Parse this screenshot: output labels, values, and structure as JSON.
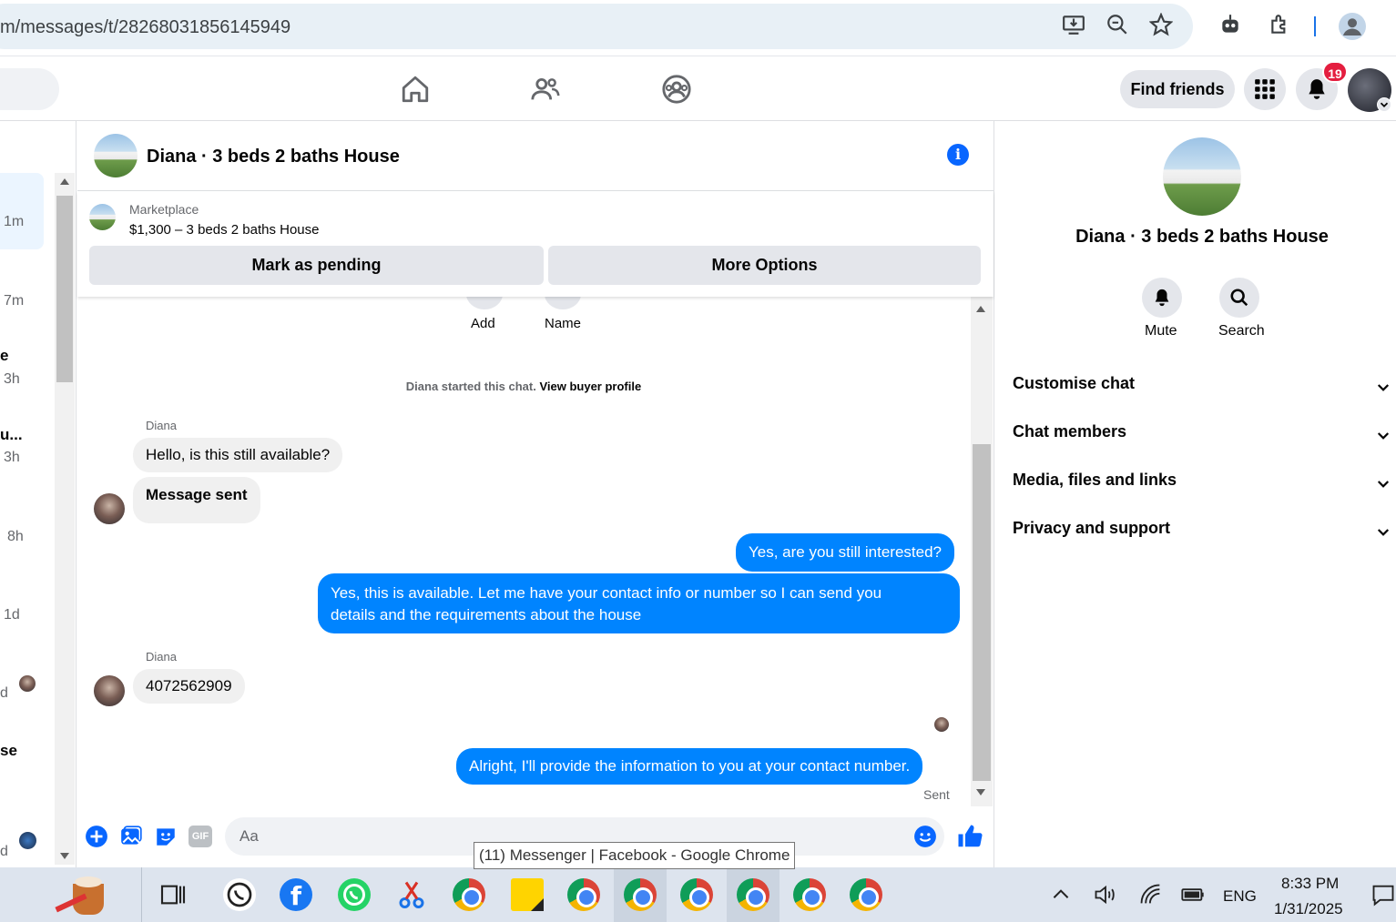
{
  "browser": {
    "url": "m/messages/t/28268031856145949",
    "tooltip": "(11) Messenger | Facebook - Google Chrome"
  },
  "nav": {
    "find_friends": "Find friends",
    "notif_count": "19"
  },
  "left_list": {
    "times": [
      "1m",
      "7m",
      "3h",
      "3h",
      "8h",
      "1d"
    ],
    "fragments": [
      "e",
      "u...",
      "d",
      "se",
      "d"
    ]
  },
  "chat": {
    "title": "Diana · 3 beds 2 baths House",
    "marketplace_label": "Marketplace",
    "marketplace_item": "$1,300 – 3 beds 2 baths House",
    "mark_pending": "Mark as pending",
    "more_options": "More Options",
    "quick_add": "Add",
    "quick_name": "Name",
    "started_text": "Diana started this chat.",
    "view_profile": "View buyer profile",
    "sender_name": "Diana",
    "msg1": "Hello, is this still available?",
    "msg2": "Message sent",
    "msg3": "Yes, are you still interested?",
    "msg4_line1": "Yes, this is available. Let me have your contact info or number so I can send you",
    "msg4_line2": "details and the requirements about the house",
    "sender_name2": "Diana",
    "msg5": "4072562909",
    "msg6": "Alright, I'll provide the information to you at your contact number.",
    "sent_status": "Sent",
    "input_placeholder": "Aa"
  },
  "right_panel": {
    "name": "Diana · 3 beds 2 baths House",
    "mute": "Mute",
    "search": "Search",
    "sections": [
      "Customise chat",
      "Chat members",
      "Media, files and links",
      "Privacy and support"
    ]
  },
  "taskbar": {
    "lang": "ENG",
    "time": "8:33 PM",
    "date": "1/31/2025"
  },
  "colors": {
    "accent": "#0866ff",
    "bubble_out": "#0084ff",
    "bubble_in": "#f0f0f0",
    "badge": "#e41e3f"
  }
}
